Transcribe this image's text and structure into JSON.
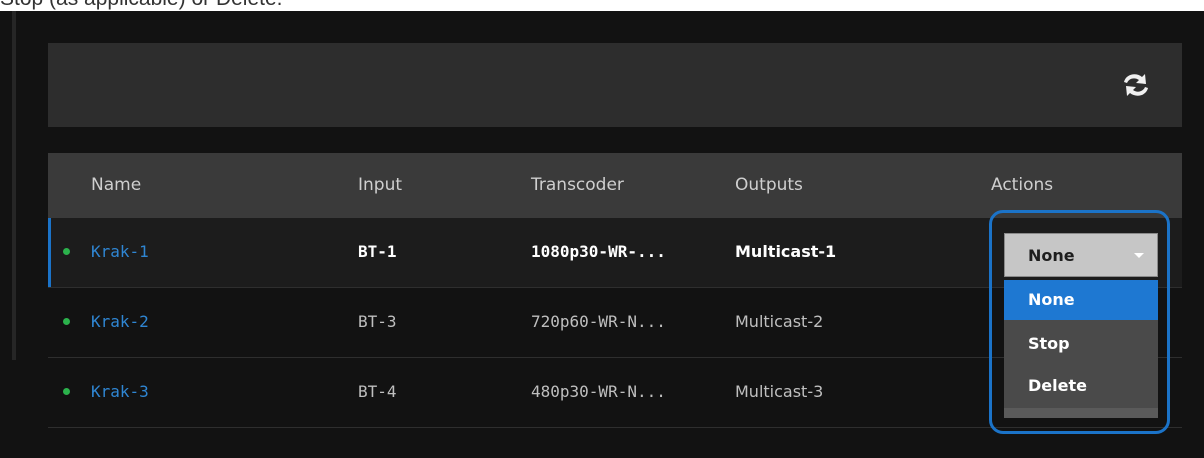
{
  "caption": "Stop (as applicable) or Delete.",
  "toolbar": {
    "refresh_icon": "refresh-icon"
  },
  "table": {
    "headers": {
      "name": "Name",
      "input": "Input",
      "transcoder": "Transcoder",
      "outputs": "Outputs",
      "actions": "Actions"
    },
    "rows": [
      {
        "name": "Krak-1",
        "input": "BT-1",
        "transcoder": "1080p30-WR-...",
        "outputs": "Multicast-1",
        "status": "online"
      },
      {
        "name": "Krak-2",
        "input": "BT-3",
        "transcoder": "720p60-WR-N...",
        "outputs": "Multicast-2",
        "status": "online"
      },
      {
        "name": "Krak-3",
        "input": "BT-4",
        "transcoder": "480p30-WR-N...",
        "outputs": "Multicast-3",
        "status": "online"
      }
    ]
  },
  "actions_dropdown": {
    "selected": "None",
    "options": [
      "None",
      "Stop",
      "Delete"
    ]
  },
  "colors": {
    "accent": "#1b73c8",
    "status_online": "#2bb24c",
    "link": "#2f86d3"
  }
}
